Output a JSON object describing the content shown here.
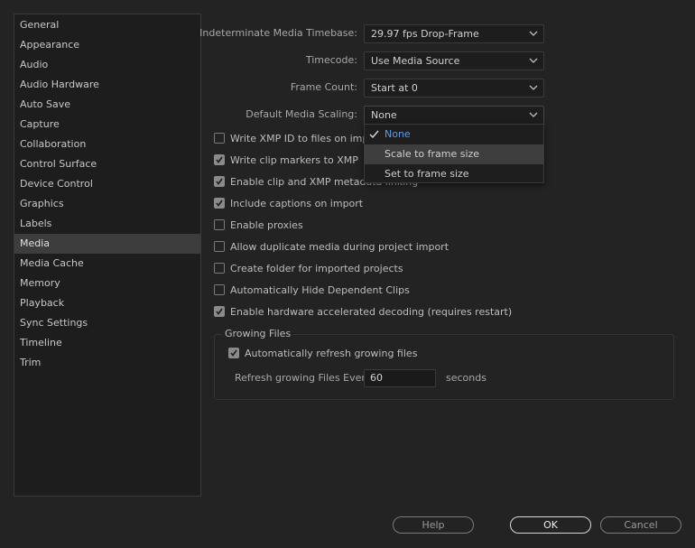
{
  "sidebar": {
    "items": [
      {
        "label": "General"
      },
      {
        "label": "Appearance"
      },
      {
        "label": "Audio"
      },
      {
        "label": "Audio Hardware"
      },
      {
        "label": "Auto Save"
      },
      {
        "label": "Capture"
      },
      {
        "label": "Collaboration"
      },
      {
        "label": "Control Surface"
      },
      {
        "label": "Device Control"
      },
      {
        "label": "Graphics"
      },
      {
        "label": "Labels"
      },
      {
        "label": "Media",
        "active": true
      },
      {
        "label": "Media Cache"
      },
      {
        "label": "Memory"
      },
      {
        "label": "Playback"
      },
      {
        "label": "Sync Settings"
      },
      {
        "label": "Timeline"
      },
      {
        "label": "Trim"
      }
    ]
  },
  "settings": {
    "timebase": {
      "label": "Indeterminate Media Timebase:",
      "value": "29.97 fps Drop-Frame"
    },
    "timecode": {
      "label": "Timecode:",
      "value": "Use Media Source"
    },
    "frame_count": {
      "label": "Frame Count:",
      "value": "Start at 0"
    },
    "scaling": {
      "label": "Default Media Scaling:",
      "value": "None"
    }
  },
  "scaling_dropdown": {
    "options": [
      {
        "label": "None",
        "selected": true
      },
      {
        "label": "Scale to frame size",
        "hover": true
      },
      {
        "label": "Set to frame size"
      }
    ]
  },
  "checkboxes": [
    {
      "label": "Write XMP ID to files on impor",
      "checked": false
    },
    {
      "label": "Write clip markers to XMP",
      "checked": true
    },
    {
      "label": "Enable clip and XMP metadata linking",
      "checked": true
    },
    {
      "label": "Include captions on import",
      "checked": true
    },
    {
      "label": "Enable proxies",
      "checked": false
    },
    {
      "label": "Allow duplicate media during project import",
      "checked": false
    },
    {
      "label": "Create folder for imported projects",
      "checked": false
    },
    {
      "label": "Automatically Hide Dependent Clips",
      "checked": false
    },
    {
      "label": "Enable hardware accelerated decoding (requires restart)",
      "checked": true
    }
  ],
  "growing_files": {
    "title": "Growing Files",
    "auto_refresh": {
      "label": "Automatically refresh growing files",
      "checked": true
    },
    "refresh_label": "Refresh growing Files Every",
    "refresh_value": "60",
    "refresh_unit": "seconds"
  },
  "buttons": {
    "help": "Help",
    "ok": "OK",
    "cancel": "Cancel"
  },
  "colors": {
    "accent": "#5d9cec",
    "background": "#232323",
    "sidebar_bg": "#1d1d1d",
    "active_item": "#3d3d3d"
  }
}
